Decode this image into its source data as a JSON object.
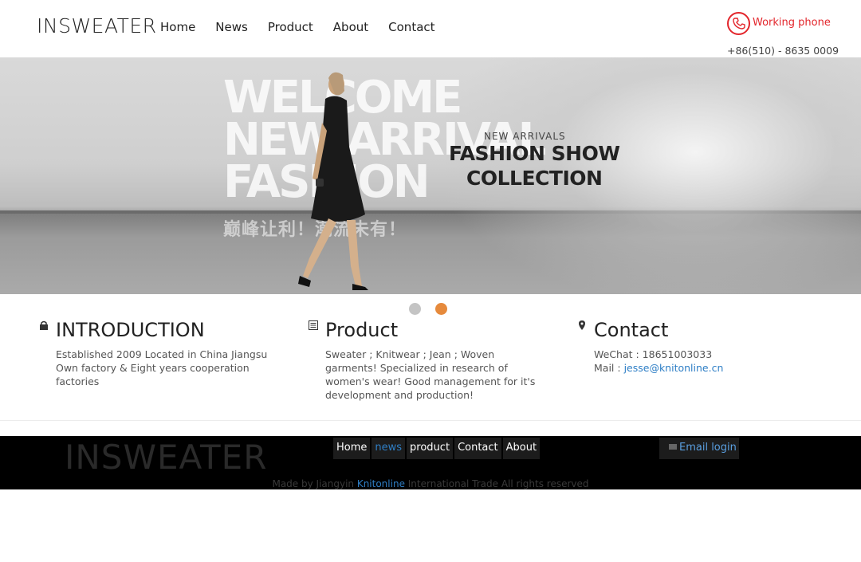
{
  "header": {
    "logo": "INSWEATER",
    "nav": [
      "Home",
      "News",
      "Product",
      "About",
      "Contact"
    ],
    "phone_label": "Working phone",
    "phone_number": "+86(510) - 8635 0009"
  },
  "banner": {
    "big_text_line1": "WELCOME",
    "big_text_line2": "NEW ARRIVAL",
    "big_text_line3": "FASHION",
    "cn_text": "巅峰让利！潮流未有！",
    "tagline": "NEW ARRIVALS",
    "headline1": "FASHION SHOW",
    "headline2": "COLLECTION",
    "slides": 2,
    "active_slide": 2
  },
  "columns": [
    {
      "title": "INTRODUCTION",
      "icon": "lock-icon",
      "lines": [
        "Established 2009 Located in China Jiangsu Own factory & Eight years cooperation factories"
      ]
    },
    {
      "title": "Product",
      "icon": "list-icon",
      "lines": [
        "Sweater ; Knitwear ; Jean ; Woven garments! Specialized in research of women's wear! Good management for it's development and production!"
      ]
    },
    {
      "title": "Contact",
      "icon": "map-pin-icon",
      "wechat": "WeChat : 18651003033",
      "mail_label": "Mail : ",
      "mail": "jesse@knitonline.cn"
    }
  ],
  "footer": {
    "logo": "INSWEATER",
    "nav": [
      "Home",
      "news",
      "product",
      "Contact",
      "About"
    ],
    "active_nav": "news",
    "email_login": "Email login",
    "copyright_pre": "Made by Jiangyin ",
    "copyright_link": "Knitonline",
    "copyright_post": " International Trade All rights reserved"
  },
  "colors": {
    "accent_red": "#e3262c",
    "link_blue": "#2f7fc6",
    "dot_active": "#e68a3c",
    "dot_inactive": "#c4c4c4"
  }
}
